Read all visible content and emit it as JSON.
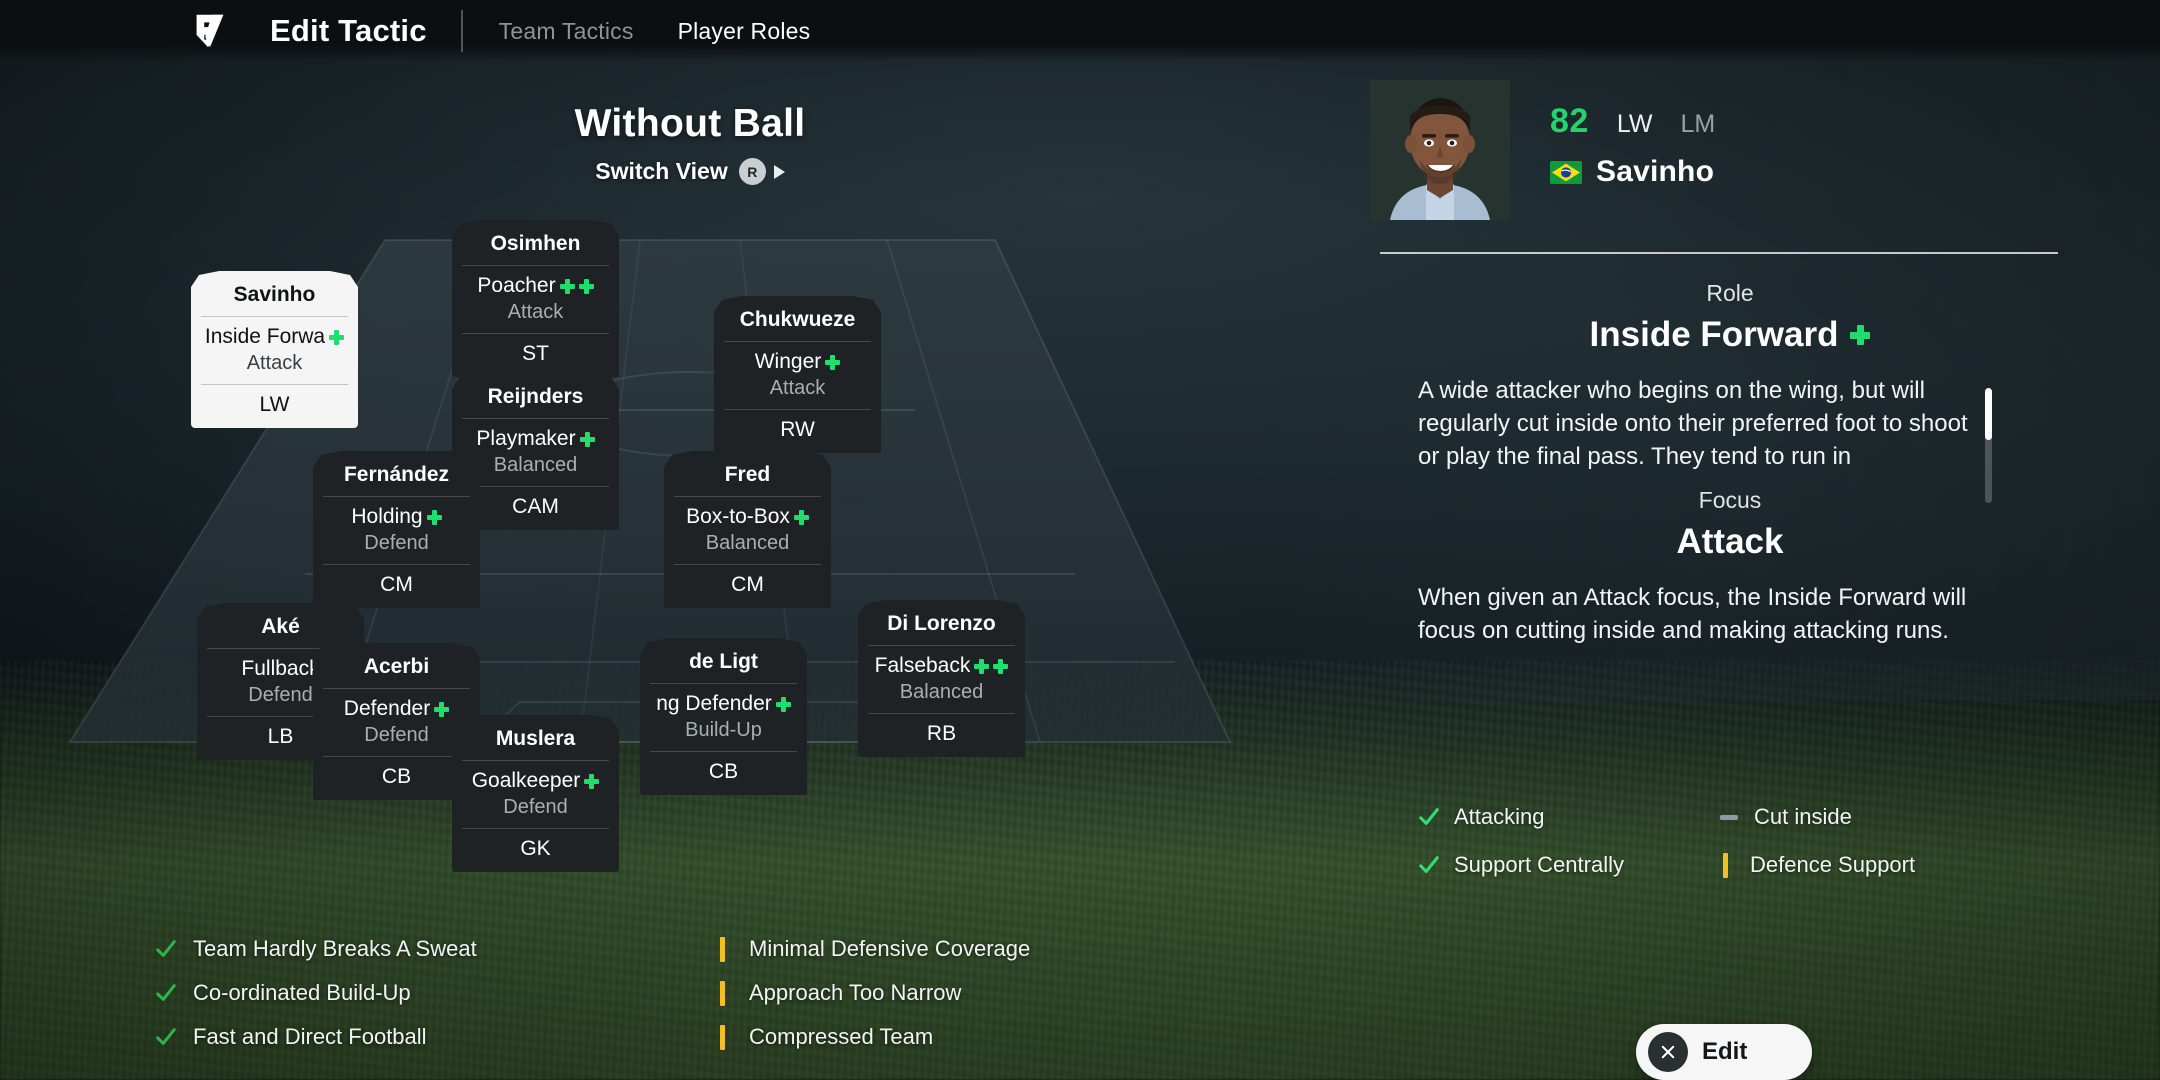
{
  "header": {
    "logo_icon": "ea-fc-logo-icon",
    "title": "Edit Tactic",
    "tabs": [
      {
        "label": "Team Tactics",
        "active": false
      },
      {
        "label": "Player Roles",
        "active": true
      }
    ]
  },
  "pitch": {
    "view_title": "Without Ball",
    "switch_view_label": "Switch View",
    "switch_view_key": "R",
    "switch_view_arrow_icon": "arrow-right-icon",
    "players": [
      {
        "name": "Osimhen",
        "role": "Poacher",
        "plus": 2,
        "focus": "Attack",
        "position": "ST",
        "selected": false
      },
      {
        "name": "Savinho",
        "role": "Inside Forwa",
        "plus": 1,
        "focus": "Attack",
        "position": "LW",
        "selected": true
      },
      {
        "name": "Chukwueze",
        "role": "Winger",
        "plus": 1,
        "focus": "Attack",
        "position": "RW",
        "selected": false
      },
      {
        "name": "Reijnders",
        "role": "Playmaker",
        "plus": 1,
        "focus": "Balanced",
        "position": "CAM",
        "selected": false
      },
      {
        "name": "Fernández",
        "role": "Holding",
        "plus": 1,
        "focus": "Defend",
        "position": "CM",
        "selected": false
      },
      {
        "name": "Fred",
        "role": "Box-to-Box",
        "plus": 1,
        "focus": "Balanced",
        "position": "CM",
        "selected": false
      },
      {
        "name": "Aké",
        "role": "Fullback",
        "plus": 0,
        "focus": "Defend",
        "position": "LB",
        "selected": false
      },
      {
        "name": "Acerbi",
        "role": "Defender",
        "plus": 1,
        "focus": "Defend",
        "position": "CB",
        "selected": false
      },
      {
        "name": "de Ligt",
        "role": "ng Defender",
        "plus": 1,
        "focus": "Build-Up",
        "position": "CB",
        "selected": false
      },
      {
        "name": "Di Lorenzo",
        "role": "Falseback",
        "plus": 2,
        "focus": "Balanced",
        "position": "RB",
        "selected": false
      },
      {
        "name": "Muslera",
        "role": "Goalkeeper",
        "plus": 1,
        "focus": "Defend",
        "position": "GK",
        "selected": false
      }
    ]
  },
  "summary": {
    "items": [
      {
        "text": "Team Hardly Breaks A Sweat",
        "icon": "check-icon",
        "column": "left"
      },
      {
        "text": "Minimal Defensive Coverage",
        "icon": "warning-bar-icon",
        "column": "right"
      },
      {
        "text": "Co-ordinated Build-Up",
        "icon": "check-icon",
        "column": "left"
      },
      {
        "text": "Approach Too Narrow",
        "icon": "warning-bar-icon",
        "column": "right"
      },
      {
        "text": "Fast and Direct Football",
        "icon": "check-icon",
        "column": "left"
      },
      {
        "text": "Compressed Team",
        "icon": "warning-bar-icon",
        "column": "right"
      }
    ]
  },
  "player_panel": {
    "portrait_icon": "player-portrait",
    "rating": "82",
    "position_primary": "LW",
    "position_secondary": "LM",
    "flag_icon": "brazil-flag-icon",
    "name": "Savinho",
    "role": {
      "kicker": "Role",
      "value": "Inside Forward",
      "plus": 1,
      "description": "A wide attacker who begins on the wing, but will regularly cut inside onto their preferred foot to shoot or play the final pass. They tend to run in"
    },
    "focus": {
      "kicker": "Focus",
      "value": "Attack",
      "description": "When given an Attack focus, the Inside Forward will focus on cutting inside and making attacking runs."
    },
    "traits": [
      {
        "text": "Attacking",
        "icon": "check-icon"
      },
      {
        "text": "Cut inside",
        "icon": "dash-icon"
      },
      {
        "text": "Support Centrally",
        "icon": "check-icon"
      },
      {
        "text": "Defence Support",
        "icon": "warning-bar-icon"
      }
    ],
    "edit_button": {
      "label": "Edit",
      "key_icon": "x-button-icon"
    }
  },
  "colors": {
    "accent_green": "#20dd6e",
    "rating_green": "#23d36c",
    "warning_yellow": "#f2c021",
    "neutral_grey": "#8d9aa0",
    "card_dark": "#1e2224",
    "card_selected": "#f5f5f5"
  }
}
